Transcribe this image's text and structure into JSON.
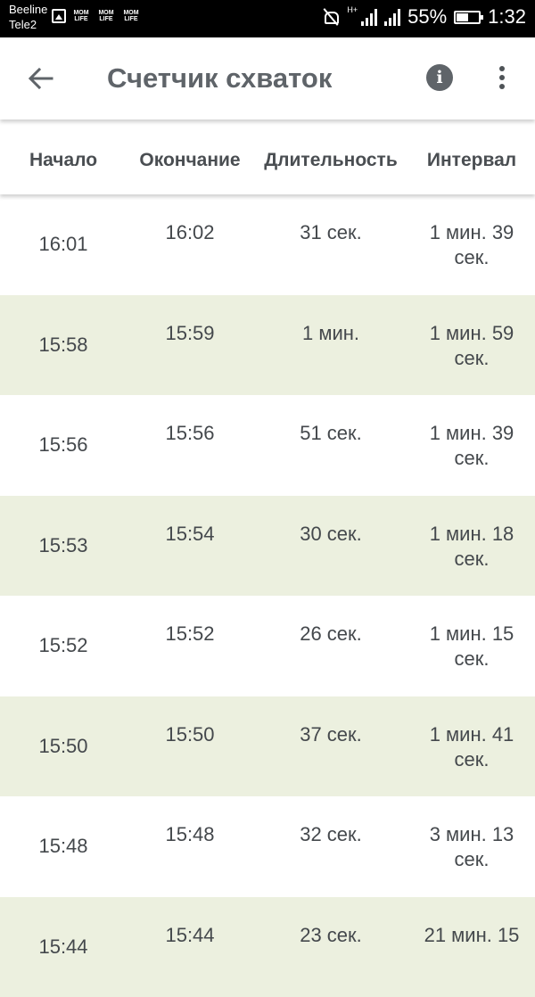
{
  "status_bar": {
    "carrier_1": "Beeline",
    "carrier_2": "Tele2",
    "app_badge": "MOM LIFE",
    "network_type": "H+",
    "battery": "55%",
    "battery_level": 0.55,
    "time": "1:32"
  },
  "app_bar": {
    "title": "Счетчик схваток",
    "back_icon": "arrow-left-icon",
    "info_icon": "info-icon",
    "info_glyph": "i",
    "menu_icon": "more-vert-icon"
  },
  "table": {
    "headers": [
      "Начало",
      "Окончание",
      "Длительность",
      "Интервал"
    ],
    "rows": [
      {
        "start": "16:01",
        "end": "16:02",
        "duration": "31 сек.",
        "interval_1": "1 мин. 39",
        "interval_2": "сек."
      },
      {
        "start": "15:58",
        "end": "15:59",
        "duration": "1 мин.",
        "interval_1": "1 мин. 59",
        "interval_2": "сек."
      },
      {
        "start": "15:56",
        "end": "15:56",
        "duration": "51 сек.",
        "interval_1": "1 мин. 39",
        "interval_2": "сек."
      },
      {
        "start": "15:53",
        "end": "15:54",
        "duration": "30 сек.",
        "interval_1": "1 мин. 18",
        "interval_2": "сек."
      },
      {
        "start": "15:52",
        "end": "15:52",
        "duration": "26 сек.",
        "interval_1": "1 мин. 15",
        "interval_2": "сек."
      },
      {
        "start": "15:50",
        "end": "15:50",
        "duration": "37 сек.",
        "interval_1": "1 мин. 41",
        "interval_2": "сек."
      },
      {
        "start": "15:48",
        "end": "15:48",
        "duration": "32 сек.",
        "interval_1": "3 мин. 13",
        "interval_2": "сек."
      },
      {
        "start": "15:44",
        "end": "15:44",
        "duration": "23 сек.",
        "interval_1": "21 мин. 15",
        "interval_2": ""
      }
    ]
  },
  "colors": {
    "alt_row": "#ecf0df",
    "title": "#5f6469",
    "status_bar": "#000000"
  }
}
